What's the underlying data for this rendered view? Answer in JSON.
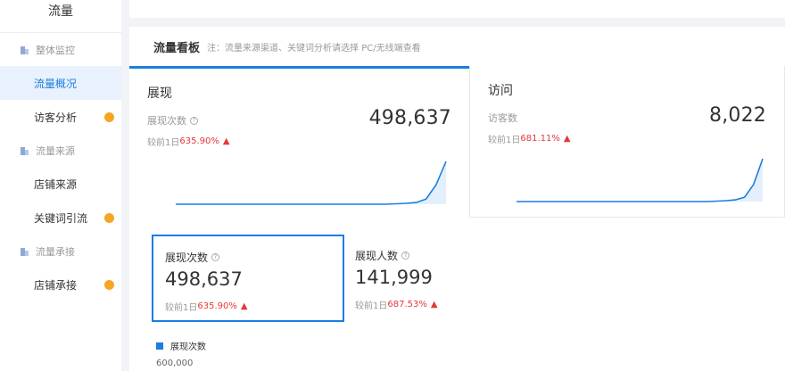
{
  "sidebar": {
    "title": "流量",
    "groups": [
      {
        "label": "整体监控",
        "items": [
          {
            "label": "流量概况",
            "active": true,
            "badge": false
          },
          {
            "label": "访客分析",
            "active": false,
            "badge": true
          }
        ]
      },
      {
        "label": "流量来源",
        "items": [
          {
            "label": "店铺来源",
            "active": false,
            "badge": false
          },
          {
            "label": "关键词引流",
            "active": false,
            "badge": true
          }
        ]
      },
      {
        "label": "流量承接",
        "items": [
          {
            "label": "店铺承接",
            "active": false,
            "badge": true
          }
        ]
      }
    ]
  },
  "panel": {
    "title": "流量看板",
    "note": "注：流量来源渠道、关键词分析请选择 PC/无线端查看"
  },
  "cards": [
    {
      "title": "展现",
      "metric_label": "展现次数",
      "value": "498,637",
      "compare_prefix": "较前1日",
      "compare_value": "635.90%",
      "trend": [
        0,
        0,
        0,
        0,
        0,
        0,
        0,
        0,
        0,
        0,
        0,
        0,
        0,
        0,
        0,
        0,
        0,
        0,
        0,
        0,
        0,
        0,
        0.01,
        0.02,
        0.04,
        0.12,
        0.45,
        1
      ]
    },
    {
      "title": "访问",
      "metric_label": "访客数",
      "value": "8,022",
      "compare_prefix": "较前1日",
      "compare_value": "681.11%",
      "trend": [
        0,
        0,
        0,
        0,
        0,
        0,
        0,
        0,
        0,
        0,
        0,
        0,
        0,
        0,
        0,
        0,
        0,
        0,
        0,
        0,
        0,
        0,
        0.01,
        0.02,
        0.04,
        0.1,
        0.4,
        1
      ]
    }
  ],
  "metrics": [
    {
      "label": "展现次数",
      "value": "498,637",
      "compare_prefix": "较前1日",
      "compare_value": "635.90%",
      "selected": true
    },
    {
      "label": "展现人数",
      "value": "141,999",
      "compare_prefix": "较前1日",
      "compare_value": "687.53%",
      "selected": false
    }
  ],
  "chart": {
    "legend": "展现次数",
    "y_top_tick": "600,000"
  },
  "colors": {
    "accent": "#1a7ee0",
    "up": "#e4393c",
    "badge": "#f5a623"
  },
  "icons": {
    "up": "▲",
    "help": "?"
  }
}
